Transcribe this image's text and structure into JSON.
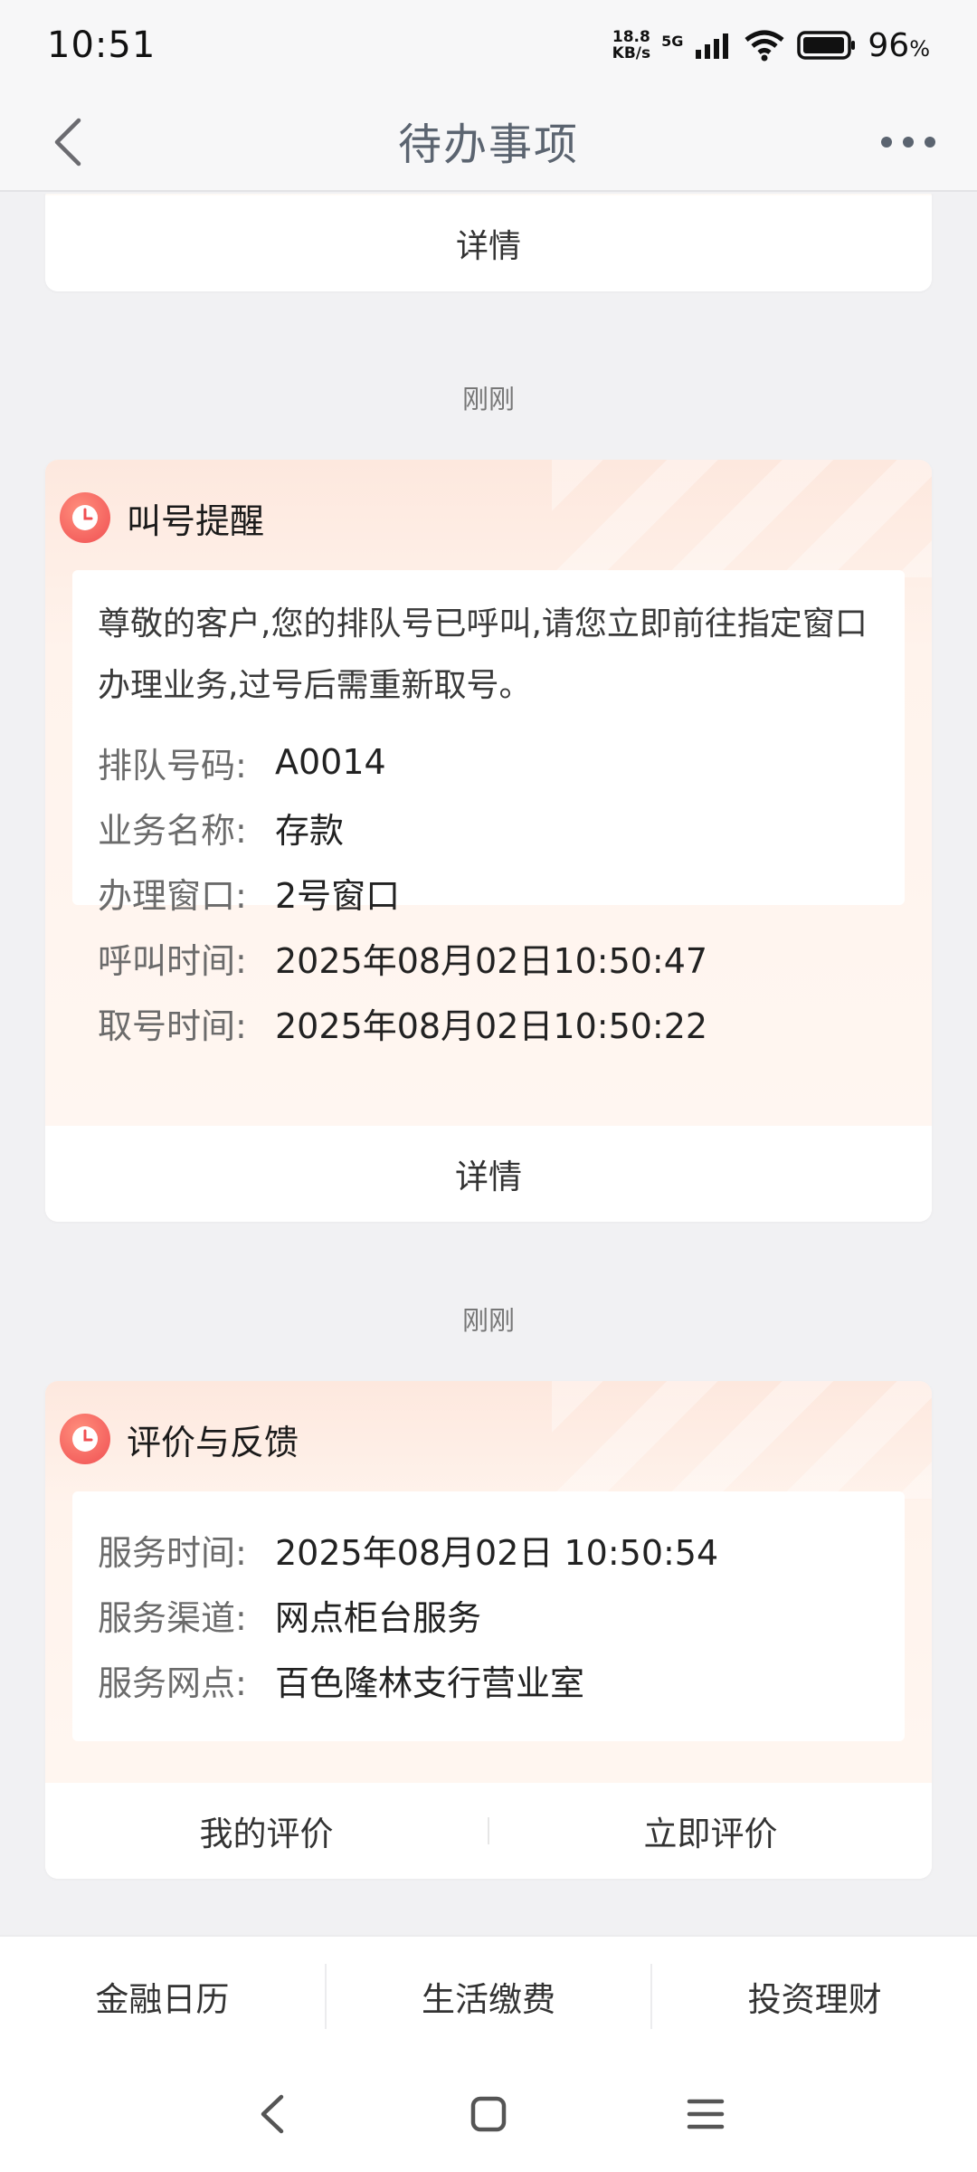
{
  "status_bar": {
    "time": "10:51",
    "net_speed_value": "18.8",
    "net_speed_unit": "KB/s",
    "network_type": "5G",
    "battery_percent": "96",
    "battery_unit": "%"
  },
  "header": {
    "title": "待办事项"
  },
  "top_card": {
    "detail_label": "详情"
  },
  "call_card": {
    "timestamp": "刚刚",
    "title": "叫号提醒",
    "message": "尊敬的客户,您的排队号已呼叫,请您立即前往指定窗口办理业务,过号后需重新取号。",
    "rows": [
      {
        "label": "排队号码:",
        "value": "A0014"
      },
      {
        "label": "业务名称:",
        "value": "存款"
      },
      {
        "label": "办理窗口:",
        "value": "2号窗口"
      },
      {
        "label": "呼叫时间:",
        "value": "2025年08月02日10:50:47"
      },
      {
        "label": "取号时间:",
        "value": "2025年08月02日10:50:22"
      }
    ],
    "detail_label": "详情"
  },
  "feedback_card": {
    "timestamp": "刚刚",
    "title": "评价与反馈",
    "rows": [
      {
        "label": "服务时间:",
        "value": "2025年08月02日 10:50:54"
      },
      {
        "label": "服务渠道:",
        "value": "网点柜台服务"
      },
      {
        "label": "服务网点:",
        "value": "百色隆林支行营业室"
      }
    ],
    "my_review_label": "我的评价",
    "review_now_label": "立即评价"
  },
  "bottom_nav": {
    "items": [
      "金融日历",
      "生活缴费",
      "投资理财"
    ]
  },
  "icons": {
    "back": "chevron-left-icon",
    "more": "more-dots-icon",
    "clock": "clock-icon"
  },
  "colors": {
    "clock_icon": "#f04f52",
    "title_text": "#5b6470",
    "card_gradient": "#fde8de"
  }
}
